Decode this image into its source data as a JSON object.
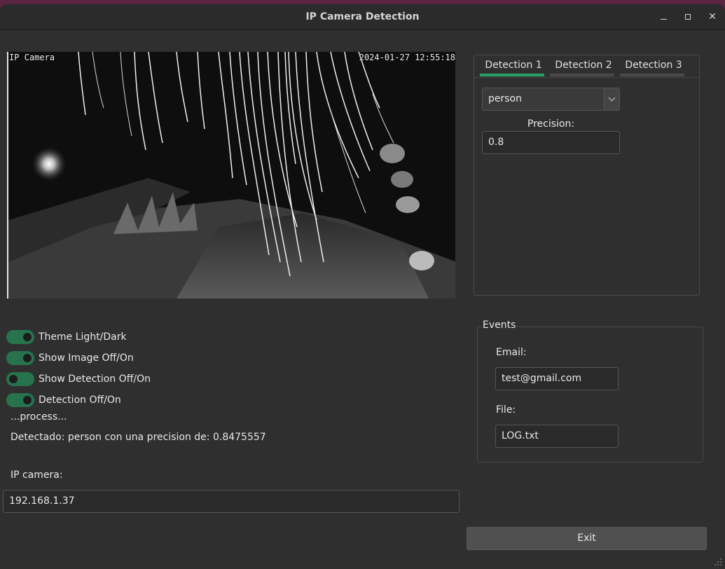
{
  "window": {
    "title": "IP Camera Detection"
  },
  "camera": {
    "overlay_name": "IP Camera",
    "overlay_timestamp": "2024-01-27 12:55:18"
  },
  "detection_tabs": {
    "tabs": [
      "Detection 1",
      "Detection 2",
      "Detection 3"
    ],
    "active_tab": "Detection 1",
    "class_select_value": "person",
    "precision_label": "Precision:",
    "precision_value": "0.8"
  },
  "toggles": [
    {
      "label": "Theme Light/Dark",
      "state": "on"
    },
    {
      "label": "Show Image Off/On",
      "state": "on"
    },
    {
      "label": "Show Detection Off/On",
      "state": "off"
    },
    {
      "label": "Detection Off/On",
      "state": "on"
    }
  ],
  "status": {
    "process_text": "...process...",
    "detected_text": "Detectado: person con una precision de: 0.8475557"
  },
  "ip_camera": {
    "label": "IP camera:",
    "value": "192.168.1.37"
  },
  "events": {
    "title": "Events",
    "email_label": "Email:",
    "email_value": "test@gmail.com",
    "file_label": "File:",
    "file_value": "LOG.txt"
  },
  "exit_label": "Exit",
  "colors": {
    "accent": "#26a269",
    "switch": "#26734d",
    "window_bg": "#2f2f2f"
  },
  "icons": [
    "minimize-icon",
    "maximize-icon",
    "close-icon",
    "chevron-down-icon",
    "resize-grip-icon"
  ]
}
